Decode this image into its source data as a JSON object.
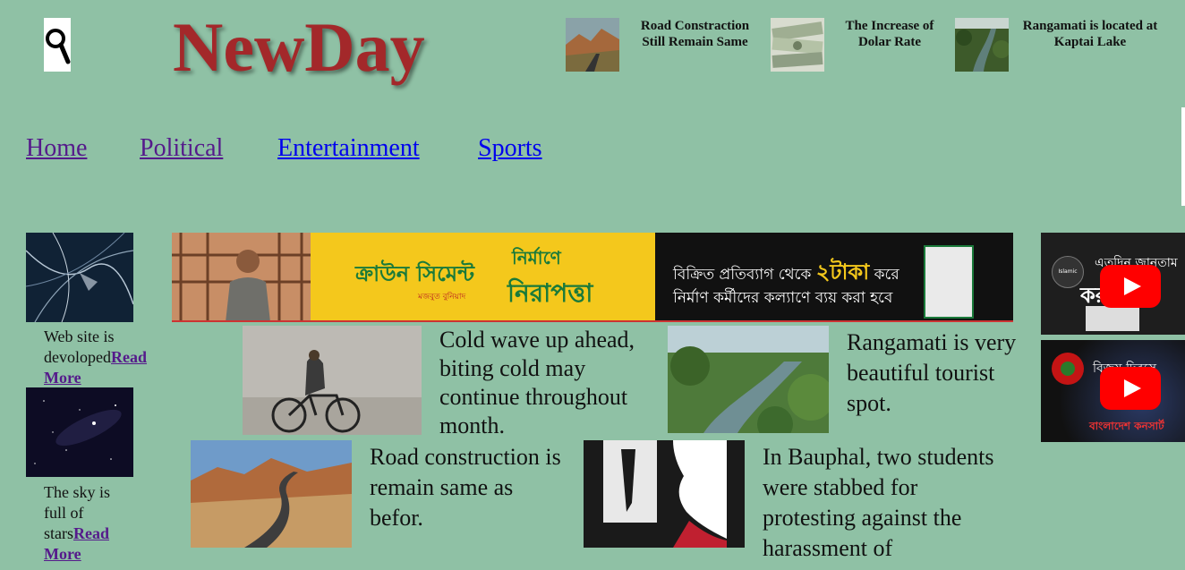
{
  "header": {
    "logo": "NewDay",
    "news": [
      {
        "title": "Road Constraction Still Remain Same"
      },
      {
        "title": "The Increase of Dolar Rate"
      },
      {
        "title": "Rangamati is located at Kaptai Lake"
      }
    ]
  },
  "nav": {
    "items": [
      "Home",
      "Political",
      "Entertainment",
      "Sports"
    ]
  },
  "sidebar": {
    "items": [
      {
        "text": "Web site is devoloped",
        "link": "Read More"
      },
      {
        "text": "The sky is full of stars",
        "link": "Read More"
      }
    ]
  },
  "banner": {
    "brand": "ক্রাউন সিমেন্ট",
    "brand_sub": "মজবুত বুনিয়াদ",
    "slogan_top": "নির্মাণে",
    "slogan_bottom": "নিরাপত্তা",
    "line1_a": "বিক্রিত প্রতিব্যাগ থেকে ",
    "line1_highlight": "২টাকা",
    "line1_b": " করে",
    "line2": "নির্মাণ কর্মীদের কল্যাণে ব্যয় করা হবে"
  },
  "articles": [
    {
      "text": "Cold wave up ahead, biting cold may continue throughout month."
    },
    {
      "text": "Rangamati is very beautiful tourist spot."
    },
    {
      "text": "Road construction is remain same as befor."
    },
    {
      "text": "In Bauphal, two students were stabbed for protesting against the harassment of"
    }
  ],
  "videos": [
    {
      "overlay": "এতদিন জানতাম",
      "overlay2": "করা",
      "channel": "Islamic Answer"
    },
    {
      "overlay": "বিজয় দিবসে",
      "overlay2": "বাংলাদেশ কনসার্ট"
    }
  ],
  "colors": {
    "background": "#8fc1a5",
    "logo": "#a3282a",
    "link": "#0000ee",
    "visited_link": "#551a8b",
    "banner_yellow": "#f4c81c",
    "youtube_red": "#ff0000"
  }
}
